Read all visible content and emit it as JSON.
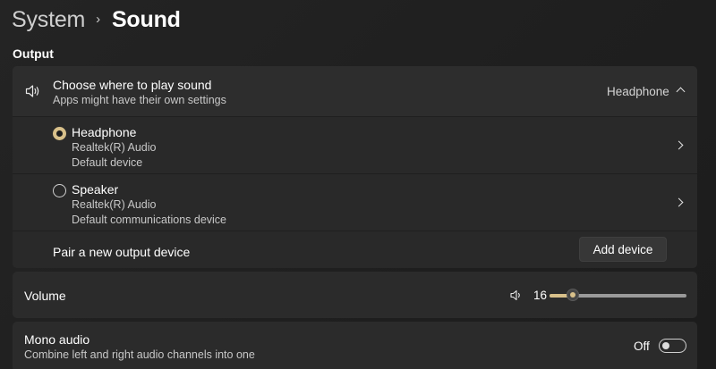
{
  "breadcrumb": {
    "parent": "System",
    "separator": "›",
    "current": "Sound"
  },
  "output_section": {
    "label": "Output",
    "choose": {
      "icon": "speaker-icon",
      "title": "Choose where to play sound",
      "subtitle": "Apps might have their own settings",
      "selected_value": "Headphone",
      "expanded": true
    },
    "devices": [
      {
        "name": "Headphone",
        "driver": "Realtek(R) Audio",
        "role": "Default device",
        "selected": true
      },
      {
        "name": "Speaker",
        "driver": "Realtek(R) Audio",
        "role": "Default communications device",
        "selected": false
      }
    ],
    "pair": {
      "label": "Pair a new output device",
      "button_label": "Add device"
    }
  },
  "volume": {
    "label": "Volume",
    "icon": "volume-icon",
    "value": "16",
    "level_percent": 16
  },
  "mono_audio": {
    "title": "Mono audio",
    "subtitle": "Combine left and right audio channels into one",
    "state_label": "Off",
    "on": false
  },
  "colors": {
    "accent": "#d8c08a",
    "background": "#202020",
    "card": "#2b2b2b"
  }
}
